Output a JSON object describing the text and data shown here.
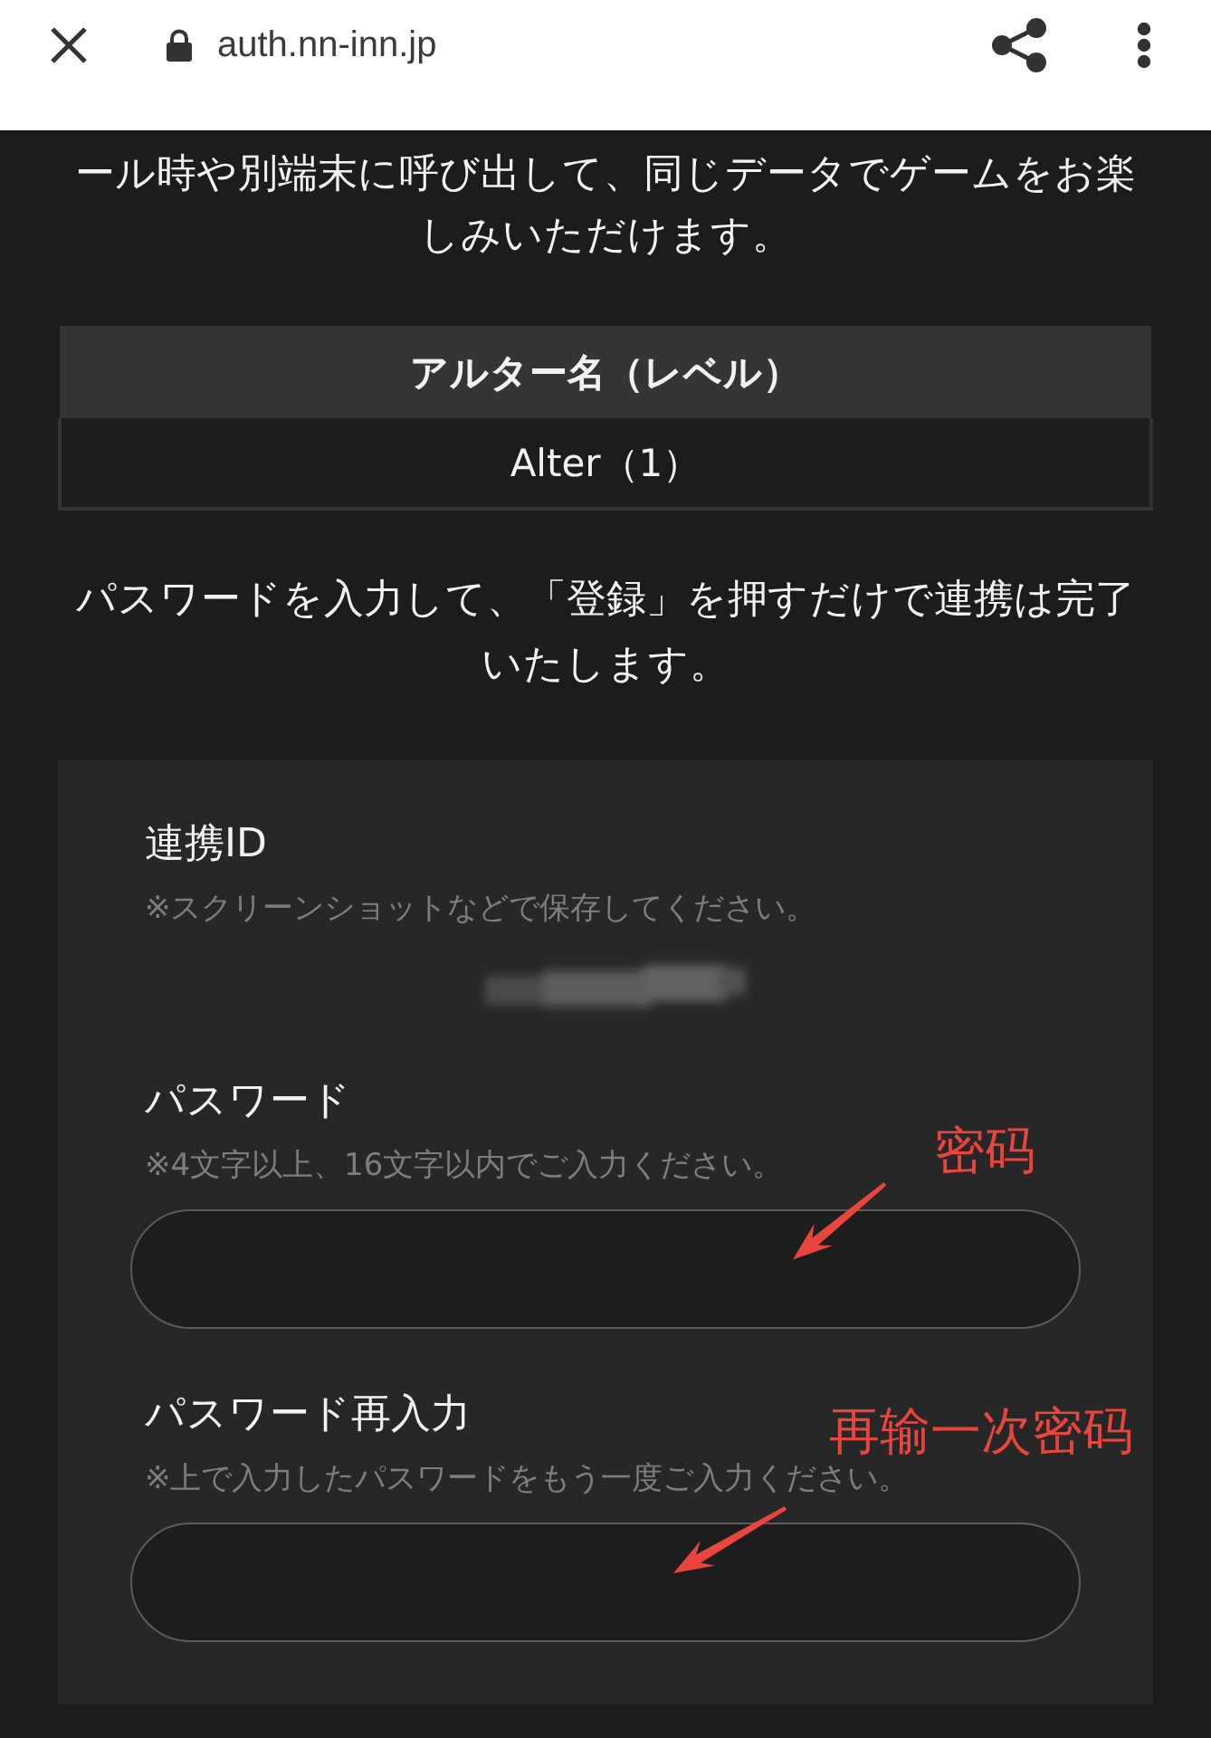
{
  "browser_bar": {
    "url": "auth.nn-inn.jp"
  },
  "intro_text": "ール時や別端末に呼び出して、同じデータでゲームをお楽しみいただけます。",
  "table": {
    "columns": [
      "アルター名（レベル）"
    ],
    "rows": [
      [
        "Alter（1）"
      ]
    ]
  },
  "instruction_text": "パスワードを入力して、「登録」を押すだけで連携は完了いたします。",
  "form": {
    "fields": [
      {
        "kind": "id",
        "label": "連携ID",
        "hint": "※スクリーンショットなどで保存してください。"
      },
      {
        "kind": "input",
        "label": "パスワード",
        "hint": "※4文字以上、16文字以内でご入力ください。",
        "annotation": "密码"
      },
      {
        "kind": "input",
        "label": "パスワード再入力",
        "hint": "※上で入力したパスワードをもう一度ご入力ください。",
        "annotation": "再输一次密码"
      }
    ]
  }
}
